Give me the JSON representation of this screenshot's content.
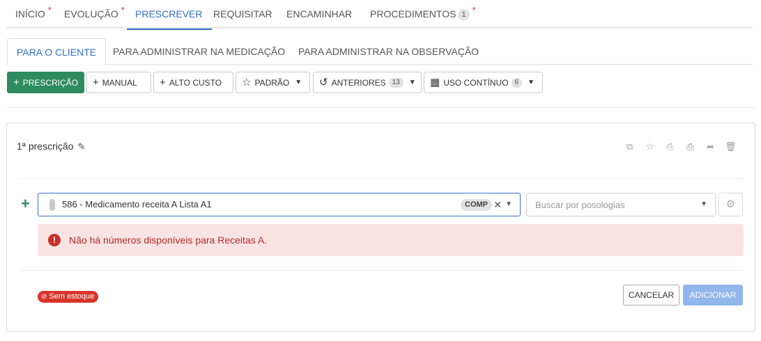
{
  "top_tabs": [
    {
      "label": "INÍCIO",
      "required": "*"
    },
    {
      "label": "EVOLUÇÃO",
      "required": "*"
    },
    {
      "label": "PRESCREVER",
      "active": true
    },
    {
      "label": "REQUISITAR"
    },
    {
      "label": "ENCAMINHAR"
    },
    {
      "label": "PROCEDIMENTOS",
      "count": "1",
      "required": "*"
    }
  ],
  "sub_tabs": [
    {
      "label": "PARA O CLIENTE",
      "active": true
    },
    {
      "label": "PARA ADMINISTRAR NA MEDICAÇÃO"
    },
    {
      "label": "PARA ADMINISTRAR NA OBSERVAÇÃO"
    }
  ],
  "toolbar": {
    "prescricao": {
      "icon": "plus-icon",
      "label": "PRESCRIÇÃO"
    },
    "manual": {
      "icon": "plus-icon",
      "label": "MANUAL"
    },
    "alto_custo": {
      "icon": "plus-icon",
      "label": "ALTO CUSTO"
    },
    "padrao": {
      "icon": "star-icon",
      "label": "PADRÃO"
    },
    "anteriores": {
      "icon": "history-icon",
      "label": "ANTERIORES",
      "count": "13"
    },
    "uso_continuo": {
      "icon": "calendar-icon",
      "label": "USO CONTÍNUO",
      "count": "6"
    }
  },
  "card": {
    "title": "1ª prescrição",
    "actions": [
      "copy-icon",
      "star-icon",
      "print-icon",
      "print-check-icon",
      "share-icon",
      "trash-icon"
    ]
  },
  "medication": {
    "value": "586 -  Medicamento receita A Lista A1",
    "tag": "COMP"
  },
  "posology": {
    "placeholder": "Buscar por posologias"
  },
  "alert": {
    "icon": "!",
    "message": "Não há números disponíveis para Receitas A."
  },
  "stock_badge": "Sem estoque",
  "footer": {
    "cancel_label": "CANCELAR",
    "add_label": "ADICIONAR"
  },
  "colors": {
    "primary_blue": "#2f6fc6",
    "green": "#2e8b60",
    "danger": "#d9342b",
    "alert_bg": "#f9e3e3",
    "add_disabled": "#90b6ec"
  }
}
